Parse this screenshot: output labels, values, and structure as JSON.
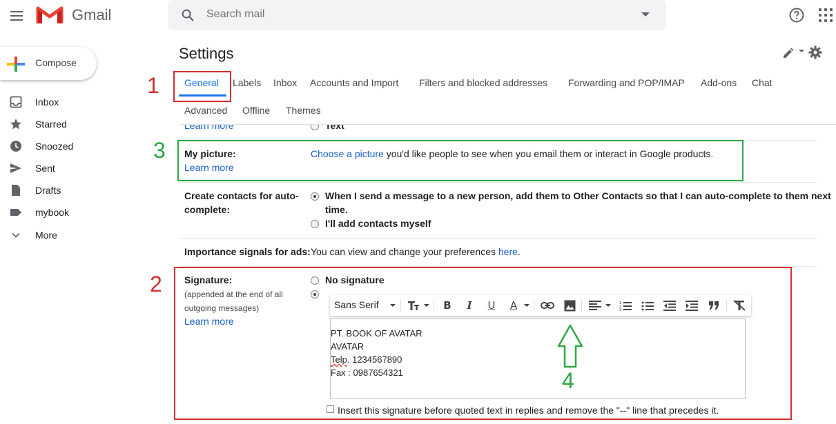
{
  "header": {
    "brand": "Gmail",
    "search_placeholder": "Search mail"
  },
  "sidebar": {
    "compose_label": "Compose",
    "items": [
      {
        "label": "Inbox",
        "icon": "inbox-icon"
      },
      {
        "label": "Starred",
        "icon": "star-icon"
      },
      {
        "label": "Snoozed",
        "icon": "clock-icon"
      },
      {
        "label": "Sent",
        "icon": "send-icon"
      },
      {
        "label": "Drafts",
        "icon": "draft-icon"
      },
      {
        "label": "mybook",
        "icon": "label-icon"
      },
      {
        "label": "More",
        "icon": "chevron-down-icon"
      }
    ]
  },
  "settings": {
    "title": "Settings",
    "tabs": [
      "General",
      "Labels",
      "Inbox",
      "Accounts and Import",
      "Filters and blocked addresses",
      "Forwarding and POP/IMAP",
      "Add-ons",
      "Chat",
      "Advanced",
      "Offline",
      "Themes"
    ],
    "active_tab": "General",
    "partial_row": {
      "learn_more": "Learn more",
      "option": "Text"
    },
    "my_picture": {
      "label": "My picture:",
      "learn_more": "Learn more",
      "link": "Choose a picture",
      "text": " you'd like people to see when you email them or interact in Google products."
    },
    "contacts": {
      "label_line1": "Create contacts for auto-",
      "label_line2": "complete:",
      "option1_line1": "When I send a message to a new person, add them to Other Contacts so that I can auto-complete to them next",
      "option1_line2": "time.",
      "option2": "I'll add contacts myself"
    },
    "importance": {
      "label": "Importance signals for ads:",
      "text": "You can view and change your preferences",
      "link": "here",
      "suffix": "."
    },
    "signature": {
      "label": "Signature:",
      "note_line1": "(appended at the end of all",
      "note_line2": "outgoing messages)",
      "learn_more": "Learn more",
      "no_signature": "No signature",
      "font": "Sans Serif",
      "lines": [
        "PT. BOOK OF AVATAR",
        "AVATAR",
        "Telp. 1234567890",
        "Fax : 0987654321"
      ],
      "insert_option": "Insert this signature before quoted text in replies and remove the \"--\" line that precedes it."
    }
  },
  "annotations": {
    "n1": "1",
    "n2": "2",
    "n3": "3",
    "n4": "4",
    "red": "#d32f2f",
    "green": "#2aa844"
  }
}
